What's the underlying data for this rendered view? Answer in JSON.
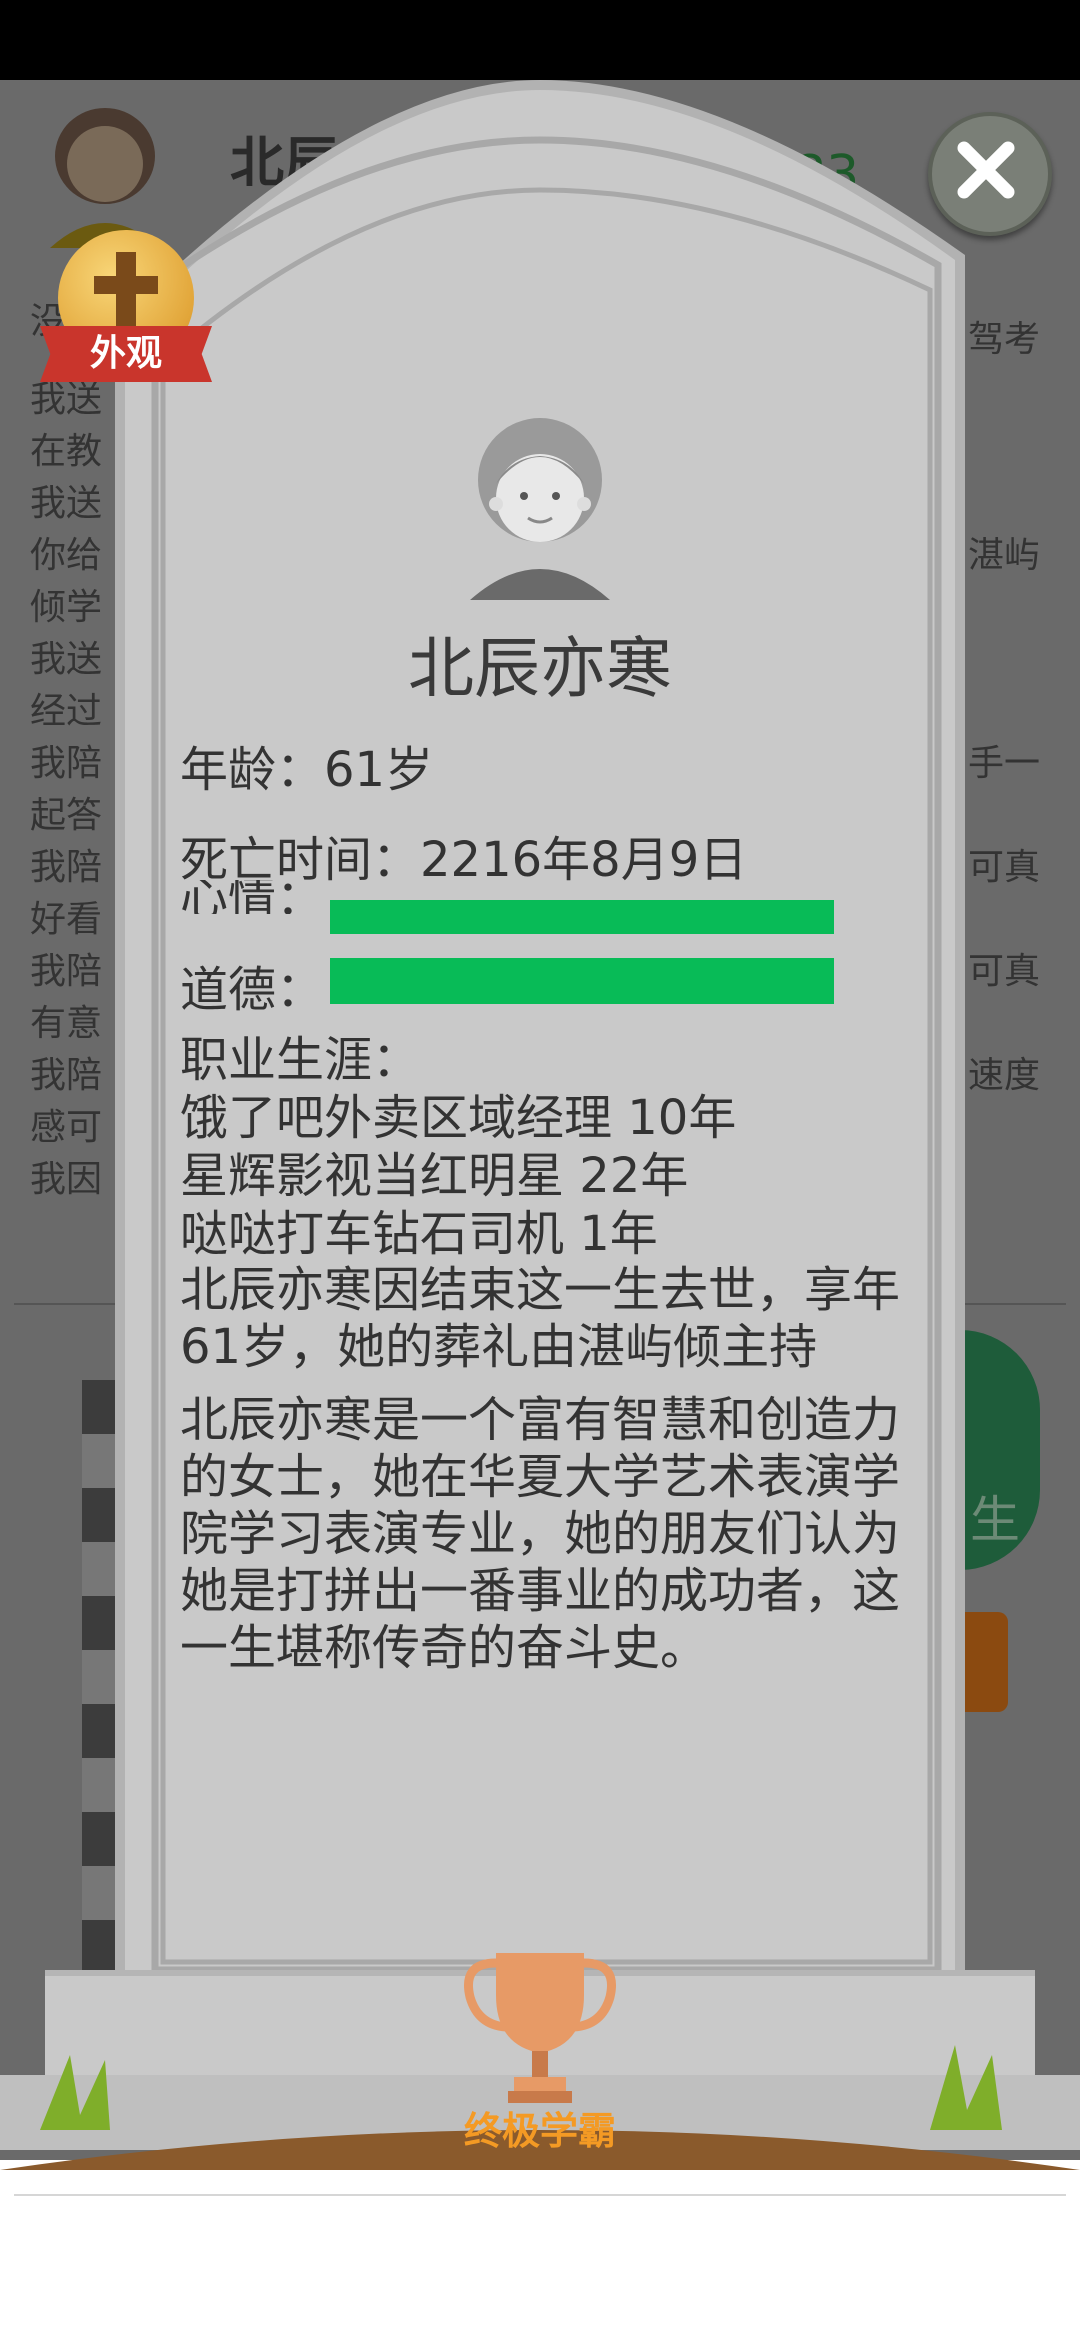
{
  "background": {
    "name_partial": "北辰亦",
    "score_partial": "583",
    "log_left": [
      "我送",
      "在教",
      "我送",
      "你给",
      "我送",
      "经过",
      "我陪",
      "我陪",
      "我陪",
      "我陪",
      "我因"
    ],
    "log_left_second": [
      "没能",
      "倾学",
      "起答",
      "好看",
      "有意",
      "感可"
    ],
    "log_right": [
      "驾考",
      "湛屿",
      "手一",
      "可真",
      "可真",
      "速度"
    ],
    "button_partial": "生"
  },
  "badge": {
    "label": "外观"
  },
  "close": {
    "icon": "close-icon"
  },
  "tomb": {
    "name": "北辰亦寒",
    "age_line": "年龄：61岁",
    "death_line": "死亡时间：2216年8月9日",
    "mood_label": "心情：",
    "moral_label": "道德：",
    "mood_level": 1.0,
    "moral_level": 1.0,
    "career_title": "职业生涯：",
    "careers": [
      "饿了吧外卖区域经理 10年",
      "星辉影视当红明星 22年",
      "哒哒打车钻石司机 1年"
    ],
    "epitaph_1": "北辰亦寒因结束这一生去世，享年61岁，她的葬礼由湛屿倾主持",
    "epitaph_2": "北辰亦寒是一个富有智慧和创造力的女士，她在华夏大学艺术表演学院学习表演专业，她的朋友们认为她是打拼出一番事业的成功者，这一生堪称传奇的奋斗史。"
  },
  "trophy": {
    "label": "终极学霸",
    "icon": "trophy-icon"
  },
  "colors": {
    "bar_green": "#08bb57",
    "trophy_text": "#f49a24",
    "ribbon": "#c9352c"
  }
}
